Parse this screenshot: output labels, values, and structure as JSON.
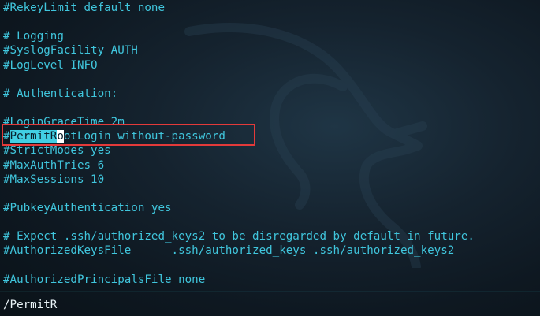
{
  "config_lines": [
    "#RekeyLimit default none",
    "",
    "# Logging",
    "#SyslogFacility AUTH",
    "#LogLevel INFO",
    "",
    "# Authentication:",
    "",
    "#LoginGraceTime 2m",
    "",
    "#StrictModes yes",
    "#MaxAuthTries 6",
    "#MaxSessions 10",
    "",
    "#PubkeyAuthentication yes",
    "",
    "# Expect .ssh/authorized_keys2 to be disregarded by default in future.",
    "#AuthorizedKeysFile      .ssh/authorized_keys .ssh/authorized_keys2",
    "",
    "#AuthorizedPrincipalsFile none"
  ],
  "match_line": {
    "prefix": "#",
    "match": "PermitR",
    "cursor_char": "o",
    "rest": "otLogin without-password"
  },
  "search": {
    "command": "/PermitR"
  },
  "colors": {
    "text": "#40c6dd",
    "highlight": "#41cfe3",
    "annotation_box": "#e33a3a",
    "background": "#15232f"
  },
  "watermark_icon": "kali-dragon-icon"
}
